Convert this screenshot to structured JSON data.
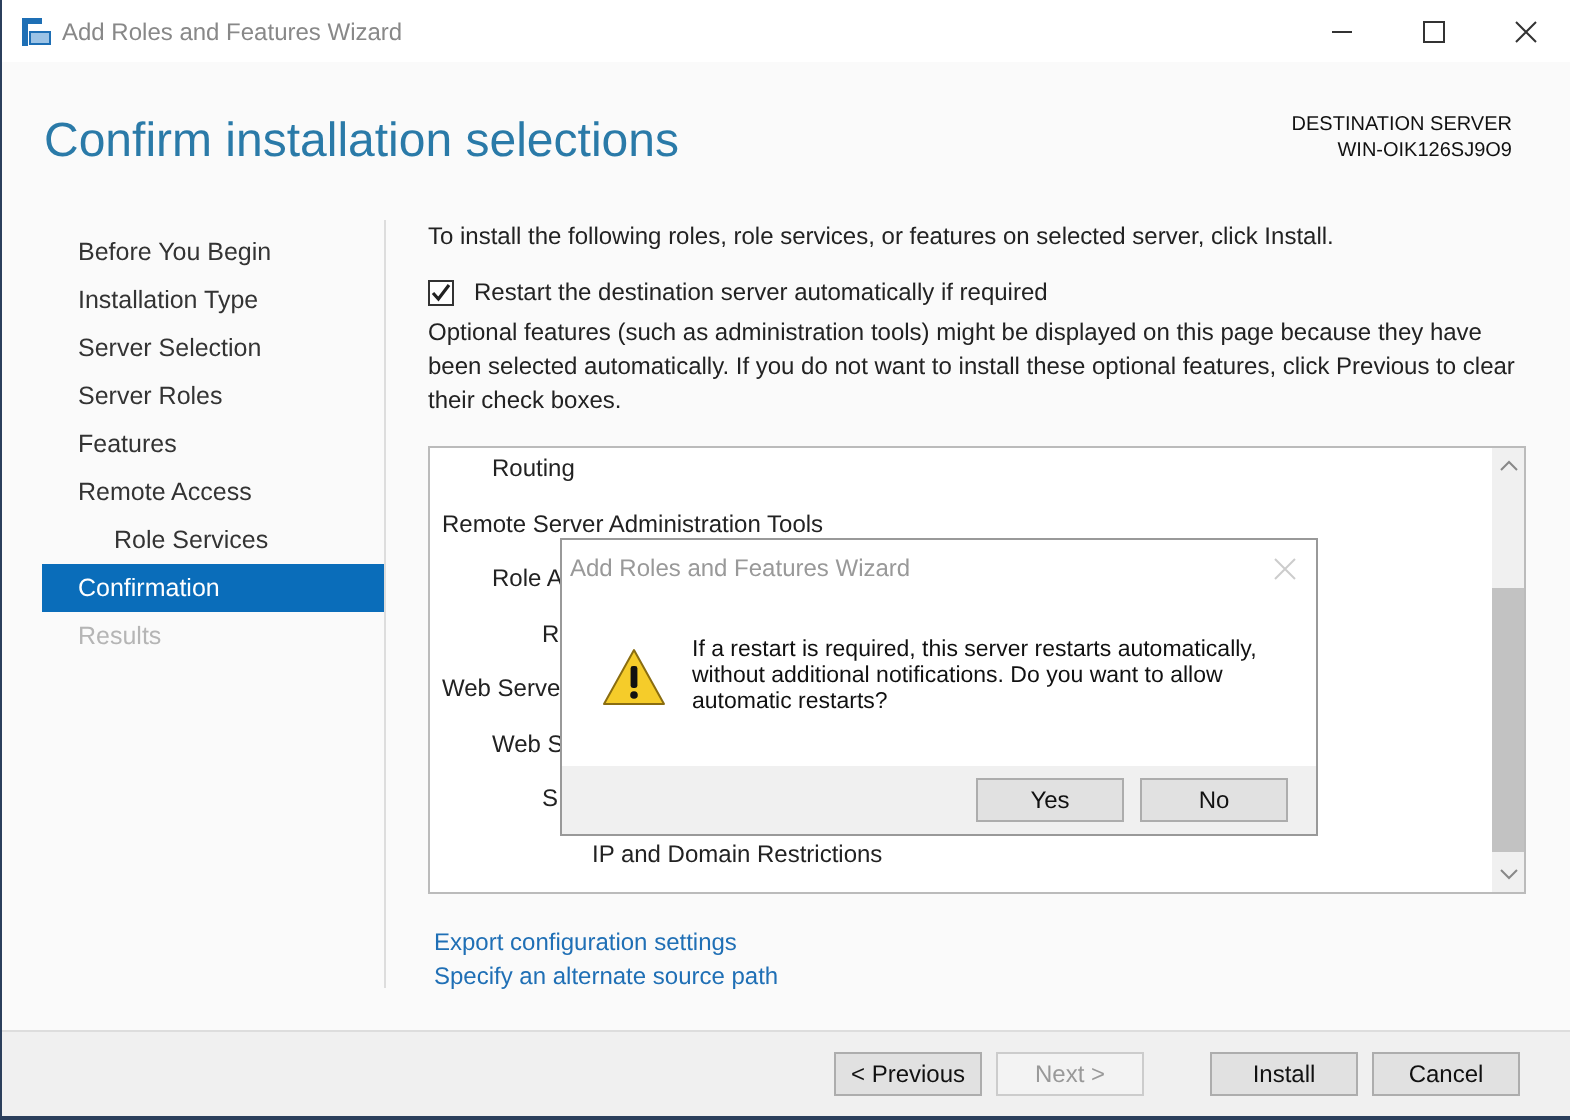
{
  "window": {
    "title": "Add Roles and Features Wizard"
  },
  "header": {
    "title": "Confirm installation selections",
    "server_label": "DESTINATION SERVER",
    "server_name": "WIN-OIK126SJ9O9"
  },
  "steps": [
    {
      "label": "Before You Begin",
      "selected": false,
      "disabled": false
    },
    {
      "label": "Installation Type",
      "selected": false,
      "disabled": false
    },
    {
      "label": "Server Selection",
      "selected": false,
      "disabled": false
    },
    {
      "label": "Server Roles",
      "selected": false,
      "disabled": false
    },
    {
      "label": "Features",
      "selected": false,
      "disabled": false
    },
    {
      "label": "Remote Access",
      "selected": false,
      "disabled": false,
      "children": [
        {
          "label": "Role Services",
          "selected": false,
          "disabled": false
        }
      ]
    },
    {
      "label": "Confirmation",
      "selected": true,
      "disabled": false
    },
    {
      "label": "Results",
      "selected": false,
      "disabled": true
    }
  ],
  "intro": "To install the following roles, role services, or features on selected server, click Install.",
  "restart_checkbox": {
    "label": "Restart the destination server automatically if required",
    "checked": true
  },
  "note": "Optional features (such as administration tools) might be displayed on this page because they have been selected automatically. If you do not want to install these optional features, click Previous to clear their check boxes.",
  "selections": [
    {
      "children": [
        {
          "label": "Routing"
        }
      ]
    },
    {
      "label": "Remote Server Administration Tools",
      "children": [
        {
          "label": "Role A",
          "children": [
            {
              "label": "R"
            }
          ]
        }
      ]
    },
    {
      "label": "Web Serve",
      "children": [
        {
          "label": "Web S",
          "children": [
            {
              "label": "S",
              "children": [
                {
                  "label": "IP and Domain Restrictions"
                }
              ]
            }
          ]
        }
      ]
    }
  ],
  "links": [
    "Export configuration settings",
    "Specify an alternate source path"
  ],
  "dialog": {
    "title": "Add Roles and Features Wizard",
    "message": "If a restart is required, this server restarts automatically, without additional notifications. Do you want to allow automatic restarts?",
    "buttons": [
      "Yes",
      "No"
    ]
  },
  "footer_buttons": [
    {
      "label": "< Previous",
      "disabled": false
    },
    {
      "label": "Next >",
      "disabled": true
    },
    {
      "label": "Install",
      "disabled": false
    },
    {
      "label": "Cancel",
      "disabled": false
    }
  ]
}
